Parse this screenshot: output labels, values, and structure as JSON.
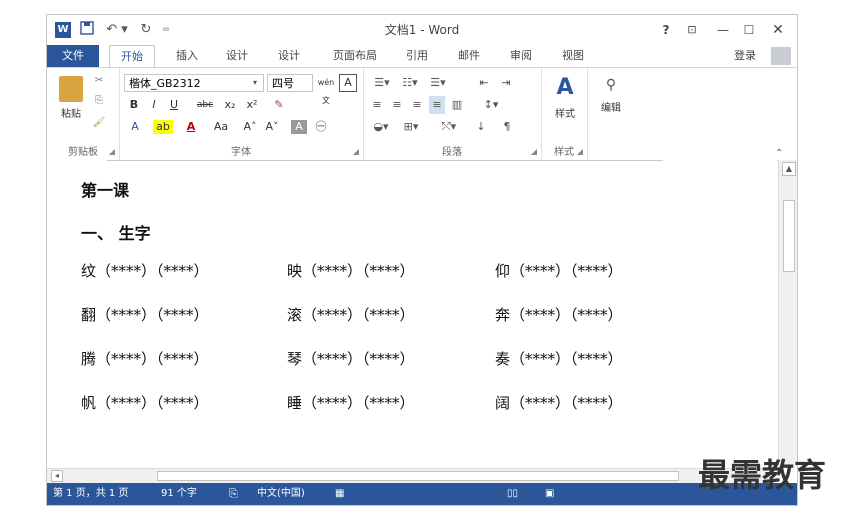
{
  "titlebar": {
    "app_icon_text": "W",
    "save_icon": "save-icon",
    "undo_label": "↶ ▾",
    "redo_label": "↻",
    "qat_more": "=",
    "title": "文档1 - Word",
    "help": "?",
    "ribbon_options": "⊡",
    "minimize": "—",
    "maximize": "☐",
    "close": "✕"
  },
  "tabs": {
    "file": "文件",
    "home": "开始",
    "insert": "插入",
    "design": "设计",
    "layout_design": "设计",
    "page_layout": "页面布局",
    "references": "引用",
    "mailings": "邮件",
    "review": "审阅",
    "view": "视图",
    "signin": "登录"
  },
  "ribbon": {
    "clipboard": {
      "paste_label": "粘贴",
      "group_label": "剪贴板"
    },
    "font": {
      "font_name": "楷体_GB2312",
      "font_size": "四号",
      "grow": "A",
      "shrink": "A",
      "phonetic": "wén 文",
      "border_char": "A",
      "bold": "B",
      "italic": "I",
      "underline": "U",
      "strikethrough": "abc",
      "subscript": "x₂",
      "superscript": "x²",
      "clear_format": "✎",
      "text_effects": "A",
      "highlight": "ab",
      "font_color": "A",
      "change_case": "Aa",
      "grow_font": "A˄",
      "shrink_font": "A˅",
      "char_shading": "A",
      "enclose": "㊀",
      "group_label": "字体"
    },
    "paragraph": {
      "group_label": "段落"
    },
    "styles": {
      "label": "样式",
      "group_label": "样式"
    },
    "editing": {
      "label": "编辑"
    }
  },
  "document": {
    "lesson_title": "第一课",
    "section_heading": "一、 生字",
    "rows": [
      [
        "纹（****）（****）",
        "映（****）（****）",
        "仰（****）（****）"
      ],
      [
        "翻（****）（****）",
        "滚（****）（****）",
        "奔（****）（****）"
      ],
      [
        "腾（****）（****）",
        "琴（****）（****）",
        "奏（****）（****）"
      ],
      [
        "帆（****）（****）",
        "睡（****）（****）",
        "阔（****）（****）"
      ]
    ],
    "paragraph_mark": "↵"
  },
  "statusbar": {
    "page": "第 1 页，共 1 页",
    "words": "91 个字",
    "proof_icon": "proofing-icon",
    "language": "中文(中国)",
    "macro_icon": "macro-icon"
  },
  "watermark": "最需教育",
  "colors": {
    "accent": "#2b579a"
  }
}
